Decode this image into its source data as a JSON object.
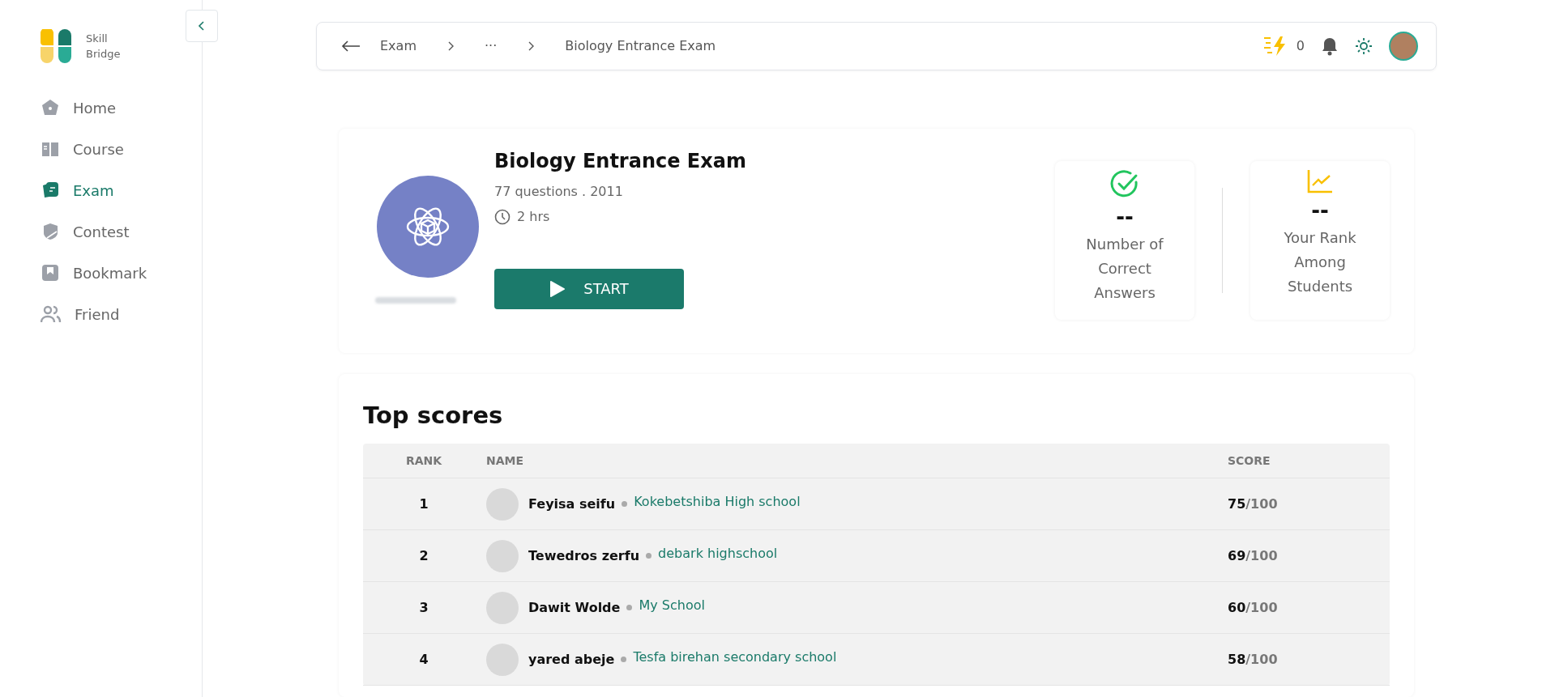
{
  "logo": {
    "line1": "Skill",
    "line2": "Bridge"
  },
  "sidebar": {
    "items": [
      {
        "label": "Home",
        "kind": "home",
        "selected": false
      },
      {
        "label": "Course",
        "kind": "book",
        "selected": false
      },
      {
        "label": "Exam",
        "kind": "exam",
        "selected": true
      },
      {
        "label": "Contest",
        "kind": "shield",
        "selected": false
      },
      {
        "label": "Bookmark",
        "kind": "bookmark",
        "selected": false
      },
      {
        "label": "Friend",
        "kind": "people",
        "selected": false
      }
    ]
  },
  "breadcrumb": [
    {
      "label": "Exam"
    },
    {
      "label": "···"
    },
    {
      "label": "Biology Entrance Exam"
    }
  ],
  "topbar": {
    "energy": "0"
  },
  "exam": {
    "title": "Biology Entrance Exam",
    "meta": "77 questions . 2011",
    "duration": "2 hrs",
    "start": "START"
  },
  "stats": [
    {
      "kind": "correct",
      "value": "--",
      "label": "Number of Correct Answers"
    },
    {
      "kind": "rank",
      "value": "--",
      "label": "Your Rank Among Students"
    }
  ],
  "top_scores": {
    "title": "Top scores",
    "columns": [
      "RANK",
      "NAME",
      "SCORE"
    ],
    "rows": [
      {
        "rank": "1",
        "name": "Feyisa seifu",
        "school": "Kokebetshiba High school",
        "score": "75",
        "total": "/100"
      },
      {
        "rank": "2",
        "name": "Tewedros zerfu",
        "school": "debark highschool",
        "score": "69",
        "total": "/100"
      },
      {
        "rank": "3",
        "name": "Dawit Wolde",
        "school": "My School",
        "score": "60",
        "total": "/100"
      },
      {
        "rank": "4",
        "name": "yared abeje",
        "school": "Tesfa birehan secondary school",
        "score": "58",
        "total": "/100"
      }
    ]
  }
}
